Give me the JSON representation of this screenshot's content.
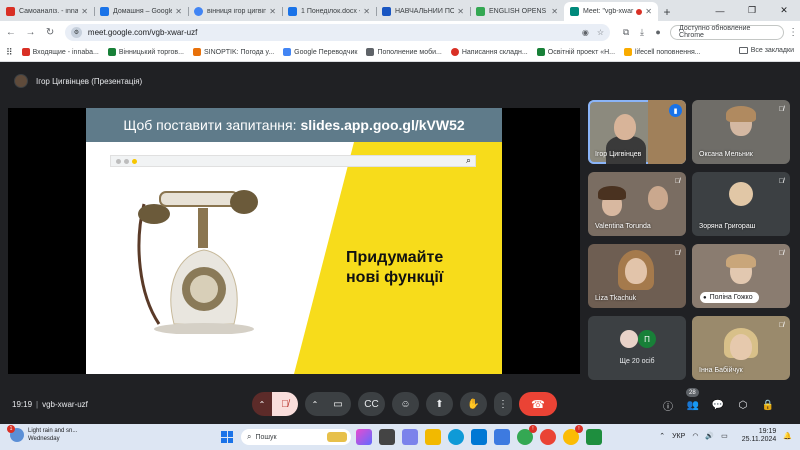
{
  "browser": {
    "tabs": [
      {
        "label": "Самоаналіз. - innaba",
        "color": "#d93025",
        "active": false
      },
      {
        "label": "Домашня – Google ,",
        "color": "#1a73e8",
        "active": false
      },
      {
        "label": "вінниця ігор цигвіn",
        "color": "#4285f4",
        "active": false
      },
      {
        "label": "1 Понеділок.docx -",
        "color": "#1a73e8",
        "active": false
      },
      {
        "label": "НАВЧАЛЬНИЙ ПОР",
        "color": "#1a56c2",
        "active": false
      },
      {
        "label": "ENGLISH OPENS THE",
        "color": "#34a853",
        "active": false
      },
      {
        "label": "Meet: \"vgb-xwar",
        "color": "#00897b",
        "active": true
      }
    ],
    "url": "meet.google.com/vgb-xwar-uzf",
    "update_button": "Доступно обновление Chrome",
    "bookmarks": [
      {
        "label": "Входящие - innaba...",
        "color": "#d93025"
      },
      {
        "label": "Вінницький торгов...",
        "color": "#188038"
      },
      {
        "label": "SINOPTIK: Погода у...",
        "color": "#e8710a"
      },
      {
        "label": "Google Переводчик",
        "color": "#4285f4"
      },
      {
        "label": "Пополнение моби...",
        "color": "#5f6368"
      },
      {
        "label": "Написання складн...",
        "color": "#d93025"
      },
      {
        "label": "Освітній проект «Н...",
        "color": "#188038"
      },
      {
        "label": "lifecell поповнення...",
        "color": "#f9ab00"
      }
    ],
    "all_bookmarks": "Все закладки"
  },
  "meet": {
    "presenter_label": "Ігор Цигвінцев (Презентація)",
    "slide": {
      "question_prefix": "Щоб поставити запитання:",
      "question_link": "slides.app.goo.gl/kVW52",
      "heading_line1": "Придумайте",
      "heading_line2": "нові функції",
      "accent": "#f7dc1b"
    },
    "participants": [
      {
        "name": "Ігор Цигвінцев",
        "speaking": true
      },
      {
        "name": "Оксана Мельник"
      },
      {
        "name": "Valentina Torunda"
      },
      {
        "name": "Зоряна Григораш"
      },
      {
        "name": "Liza Tkachuk"
      },
      {
        "name": "Поліна Гожко"
      },
      {
        "name": "Інна Бабійчук"
      }
    ],
    "more_label": "Ще 20 осіб",
    "more_avatar_letter": "П",
    "time": "19:19",
    "meeting_code": "vgb-xwar-uzf",
    "participant_count": "28"
  },
  "taskbar": {
    "weather_line1": "Light rain and sn...",
    "weather_line2": "Wednesday",
    "weather_badge": "1",
    "search_placeholder": "Пошук",
    "lang": "УКР",
    "time": "19:19",
    "date": "25.11.2024"
  }
}
